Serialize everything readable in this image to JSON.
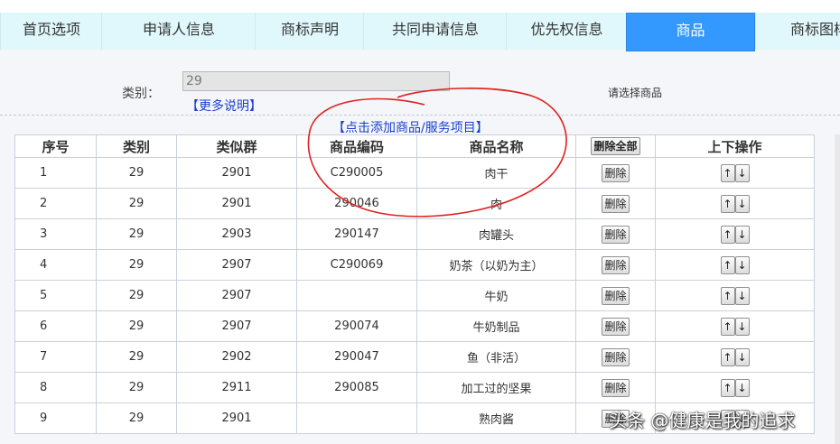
{
  "tabs": [
    {
      "label": "首页选项"
    },
    {
      "label": "申请人信息"
    },
    {
      "label": "商标声明"
    },
    {
      "label": "共同申请信息"
    },
    {
      "label": "优先权信息"
    },
    {
      "label": "商品"
    },
    {
      "label": "商标图样"
    }
  ],
  "active_tab": "商品",
  "category": {
    "label": "类别：",
    "value": "29",
    "more_link": "【更多说明】",
    "hint": "请选择商品"
  },
  "add_link": "【点击添加商品/服务项目】",
  "table": {
    "headers": [
      "序号",
      "类别",
      "类似群",
      "商品编码",
      "商品名称",
      "删除全部",
      "上下操作"
    ],
    "delete_label": "删除",
    "up_label": "↑",
    "down_label": "↓",
    "rows": [
      {
        "seq": "1",
        "cls": "29",
        "group": "2901",
        "code": "C290005",
        "name": "肉干"
      },
      {
        "seq": "2",
        "cls": "29",
        "group": "2901",
        "code": "290046",
        "name": "肉"
      },
      {
        "seq": "3",
        "cls": "29",
        "group": "2903",
        "code": "290147",
        "name": "肉罐头"
      },
      {
        "seq": "4",
        "cls": "29",
        "group": "2907",
        "code": "C290069",
        "name": "奶茶（以奶为主）"
      },
      {
        "seq": "5",
        "cls": "29",
        "group": "2907",
        "code": "",
        "name": "牛奶"
      },
      {
        "seq": "6",
        "cls": "29",
        "group": "2907",
        "code": "290074",
        "name": "牛奶制品"
      },
      {
        "seq": "7",
        "cls": "29",
        "group": "2902",
        "code": "290047",
        "name": "鱼（非活）"
      },
      {
        "seq": "8",
        "cls": "29",
        "group": "2911",
        "code": "290085",
        "name": "加工过的坚果"
      },
      {
        "seq": "9",
        "cls": "29",
        "group": "2901",
        "code": "",
        "name": "熟肉酱"
      }
    ]
  },
  "watermark": "头条 @健康是我的追求",
  "colors": {
    "active_tab": "#3399ff",
    "tab": "#e0f8fb",
    "link": "#1a3fd0",
    "annotation": "#e02020"
  }
}
